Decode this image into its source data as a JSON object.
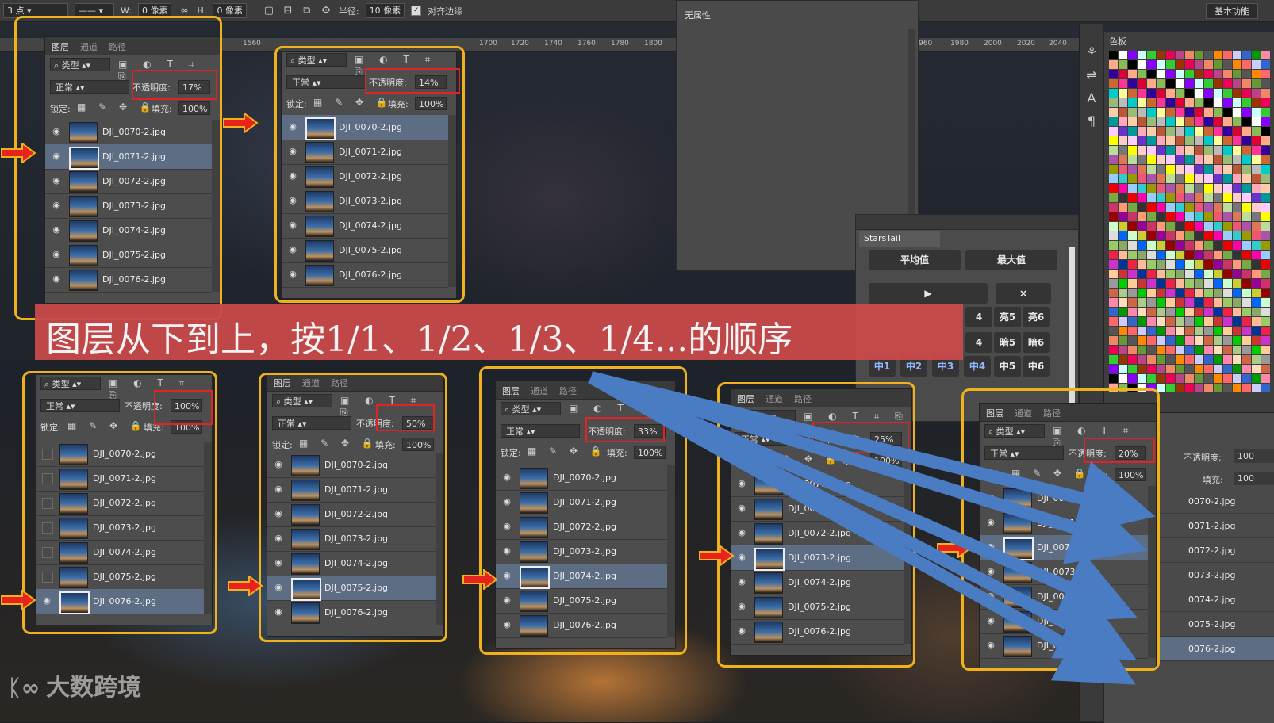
{
  "toolbar": {
    "stroke_size": "3 点",
    "w_label": "W:",
    "w_value": "0 像素",
    "h_label": "H:",
    "h_value": "0 像素",
    "radius_label": "半径:",
    "radius_value": "10 像素",
    "align_edges": "对齐边缘",
    "workspace": "基本功能"
  },
  "ruler": [
    "1560",
    "1700",
    "1720",
    "1740",
    "1760",
    "1780",
    "1800",
    "960",
    "1980",
    "2000",
    "2020",
    "2040"
  ],
  "properties_title": "无属性",
  "swatches_tab": "色板",
  "starstail": {
    "title": "StarsTail",
    "avg": "平均值",
    "max": "最大值",
    "play": "▶",
    "close": "×",
    "row1": [
      "4",
      "亮5",
      "亮6"
    ],
    "row2": [
      "4",
      "暗5",
      "暗6"
    ],
    "row3": [
      "中1",
      "中2",
      "中3",
      "中4",
      "中5",
      "中6"
    ]
  },
  "panel_ui": {
    "tab_layers": "图层",
    "tab_channels": "通道",
    "tab_paths": "路径",
    "kind": "类型",
    "blend_mode": "正常",
    "opacity_label": "不透明度:",
    "lock_label": "锁定:",
    "fill_label": "填充:",
    "fill_value": "100%"
  },
  "layer_names": [
    "DJI_0070-2.jpg",
    "DJI_0071-2.jpg",
    "DJI_0072-2.jpg",
    "DJI_0073-2.jpg",
    "DJI_0074-2.jpg",
    "DJI_0075-2.jpg",
    "DJI_0076-2.jpg"
  ],
  "panels": [
    {
      "opacity": "17%"
    },
    {
      "opacity": "14%"
    },
    {
      "opacity": "100%"
    },
    {
      "opacity": "50%"
    },
    {
      "opacity": "33%"
    },
    {
      "opacity": "25%"
    },
    {
      "opacity": "20%"
    }
  ],
  "right_layers": [
    "0070-2.jpg",
    "0071-2.jpg",
    "0072-2.jpg",
    "0073-2.jpg",
    "0074-2.jpg",
    "0075-2.jpg",
    "0076-2.jpg"
  ],
  "right_opacity_label": "不透明度:",
  "right_opacity_value": "100",
  "right_fill_label": "填充:",
  "right_fill_value": "100",
  "banner": "图层从下到上，按1/1、1/2、1/3、1/4...的顺序",
  "watermark": "大数跨境",
  "colors": {
    "highlight_frame": "#f0b21c",
    "callout_box": "#e02424",
    "banner": "#c9494a",
    "selected_row": "#5d6d84",
    "arrow_blue": "#4a7cc4"
  }
}
